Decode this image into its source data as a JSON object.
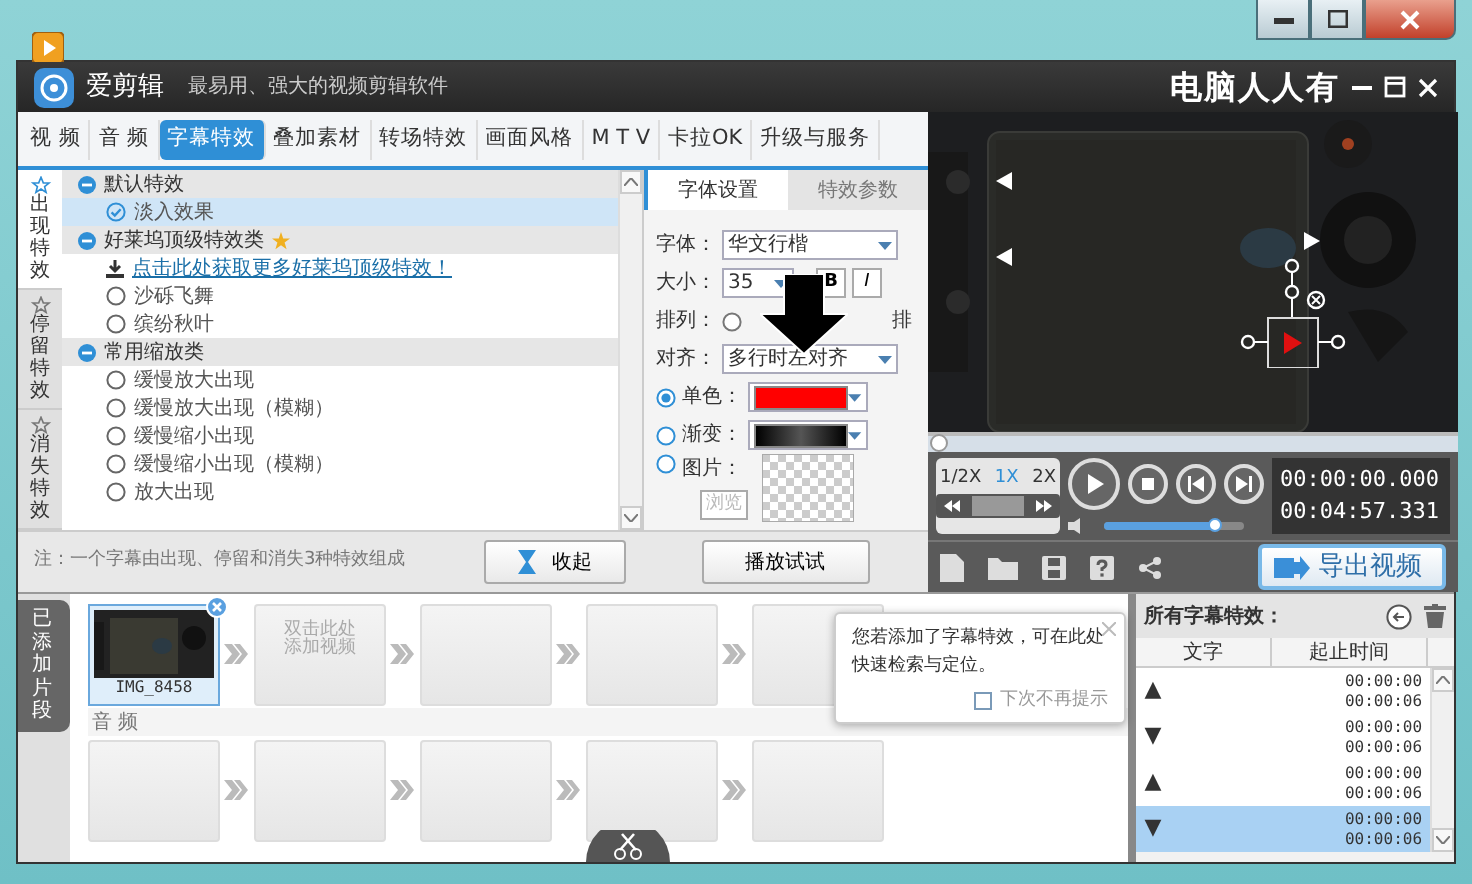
{
  "app": {
    "name": "爱剪辑",
    "slogan": "最易用、强大的视频剪辑软件",
    "caption": "电脑人人有"
  },
  "tabs": [
    {
      "label": "视 频",
      "selected": false
    },
    {
      "label": "音 频",
      "selected": false
    },
    {
      "label": "字幕特效",
      "selected": true
    },
    {
      "label": "叠加素材",
      "selected": false
    },
    {
      "label": "转场特效",
      "selected": false
    },
    {
      "label": "画面风格",
      "selected": false
    },
    {
      "label": "M T V",
      "selected": false
    },
    {
      "label": "卡拉OK",
      "selected": false
    },
    {
      "label": "升级与服务",
      "selected": false
    }
  ],
  "effect_sidebar": [
    {
      "label": "出现特效",
      "selected": true
    },
    {
      "label": "停留特效",
      "selected": false
    },
    {
      "label": "消失特效",
      "selected": false
    }
  ],
  "effect_groups": [
    {
      "title": "默认特效",
      "featured": false,
      "items": [
        {
          "kind": "radio",
          "label": "淡入效果",
          "selected": true
        }
      ]
    },
    {
      "title": "好莱坞顶级特效类",
      "featured": true,
      "items": [
        {
          "kind": "link",
          "label": "点击此处获取更多好莱坞顶级特效！"
        },
        {
          "kind": "radio",
          "label": "沙砾飞舞",
          "selected": false
        },
        {
          "kind": "radio",
          "label": "缤纷秋叶",
          "selected": false
        }
      ]
    },
    {
      "title": "常用缩放类",
      "featured": false,
      "items": [
        {
          "kind": "radio",
          "label": "缓慢放大出现",
          "selected": false
        },
        {
          "kind": "radio",
          "label": "缓慢放大出现（模糊）",
          "selected": false
        },
        {
          "kind": "radio",
          "label": "缓慢缩小出现",
          "selected": false
        },
        {
          "kind": "radio",
          "label": "缓慢缩小出现（模糊）",
          "selected": false
        },
        {
          "kind": "radio",
          "label": "放大出现",
          "selected": false
        }
      ]
    }
  ],
  "note": "注：一个字幕由出现、停留和消失3种特效组成",
  "collapse_button": "收起",
  "settings_tabs": [
    {
      "label": "字体设置",
      "selected": true
    },
    {
      "label": "特效参数",
      "selected": false
    }
  ],
  "font_settings": {
    "font_label": "字体：",
    "font": "华文行楷",
    "size_label": "大小：",
    "size": "35",
    "bold": "B",
    "italic": "I",
    "layout_label": "排列：",
    "layout_option": "排",
    "align_label": "对齐：",
    "align": "多行时左对齐",
    "fills": [
      {
        "kind": "solid",
        "label": "单色：",
        "selected": true,
        "color": "#ff0000"
      },
      {
        "kind": "gradient",
        "label": "渐变：",
        "selected": false
      },
      {
        "label": "图片：",
        "selected": false
      }
    ],
    "browse_button": {
      "label": "浏览",
      "disabled": true
    }
  },
  "preview_button": "播放试试",
  "player": {
    "progress": {
      "level": 0.0
    },
    "speeds": [
      {
        "label": "1/2X",
        "selected": false
      },
      {
        "label": "1X",
        "selected": true
      },
      {
        "label": "2X",
        "selected": false
      }
    ],
    "current_time": "00:00:00.000",
    "total_time": "00:04:57.331",
    "volume": {
      "level": 0.78
    },
    "export_button": "导出视频"
  },
  "timeline": {
    "label": "已添加片段",
    "clips": [
      {
        "kind": "clip",
        "name": "IMG_8458"
      },
      {
        "kind": "add",
        "text": "双击此处添加视频"
      },
      {
        "kind": "empty"
      },
      {
        "kind": "empty"
      },
      {
        "kind": "empty"
      }
    ],
    "audio_label": "音 频",
    "audio_slots": [
      {
        "kind": "empty"
      },
      {
        "kind": "empty"
      },
      {
        "kind": "empty"
      },
      {
        "kind": "empty"
      },
      {
        "kind": "empty"
      }
    ]
  },
  "tip": {
    "text": "您若添加了字幕特效，可在此处快速检索与定位。",
    "checkbox": {
      "label": "下次不再提示",
      "checked": false
    }
  },
  "subtitle_list": {
    "title": "所有字幕特效：",
    "columns": [
      "文字",
      "起止时间"
    ],
    "rows": [
      {
        "marker": "▲",
        "start": "00:00:00",
        "end": "00:00:06",
        "selected": false
      },
      {
        "marker": "▼",
        "start": "00:00:00",
        "end": "00:00:06",
        "selected": false
      },
      {
        "marker": "▲",
        "start": "00:00:00",
        "end": "00:00:06",
        "selected": false
      },
      {
        "marker": "▼",
        "start": "00:00:00",
        "end": "00:00:06",
        "selected": true
      }
    ]
  }
}
